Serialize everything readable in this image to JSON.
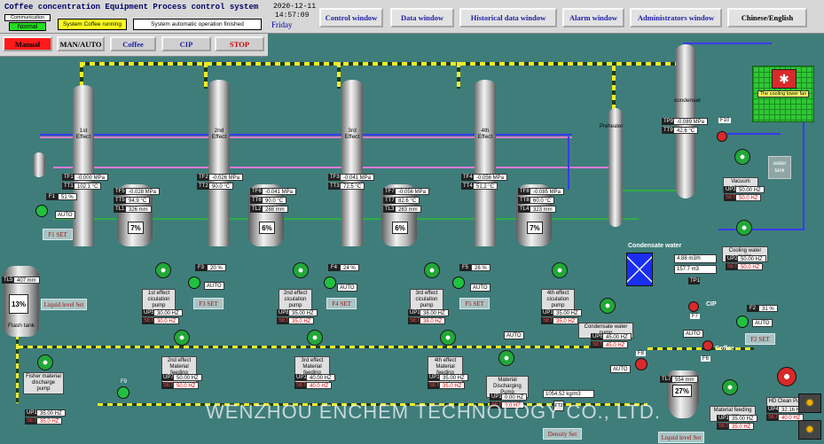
{
  "header": {
    "title": "Coffee concentration Equipment  Process control system",
    "communication_label": "Communication",
    "status_normal": "Normal",
    "status_running": "System Coffee running",
    "status_message": "System automatic operation finished",
    "date": "2020-12-11",
    "time": "14:57:09",
    "weekday": "Friday"
  },
  "controls": {
    "manual": "Manual",
    "man_auto": "MAN/AUTO",
    "coffee": "Coffee",
    "cip": "CIP",
    "stop": "STOP"
  },
  "nav": [
    "Control window",
    "Data window",
    "Historical data window",
    "Alarm window",
    "Administrators window",
    "Chinese/English"
  ],
  "columns": [
    {
      "label": "1st Effect",
      "tf_tag": "TF1",
      "tf": "-0.000 MPa",
      "tt_tag": "TT1",
      "tt": "102.1 °C",
      "pct": "7%"
    },
    {
      "label": "2nd Effect",
      "tf_tag": "TF2",
      "tf": "-0.026 MPa",
      "tt_tag": "TT2",
      "tt": "90.0 °C",
      "pct": "6%"
    },
    {
      "label": "3rd Effect",
      "tf_tag": "TF3",
      "tf": "-0.041 MPa",
      "tt_tag": "TT3",
      "tt": "72.5 °C",
      "pct": "6%"
    },
    {
      "label": "4th Effect",
      "tf_tag": "TF4",
      "tf": "-0.056 MPa",
      "tt_tag": "TT4",
      "tt": "51.2 °C",
      "pct": "7%"
    }
  ],
  "tanks": [
    {
      "a_tag": "TF5",
      "a": "-0.028 MPa",
      "b_tag": "TT5",
      "b": "94.9 °C",
      "c_tag": "TL1",
      "c": "326 mm"
    },
    {
      "a_tag": "TF6",
      "a": "-0.041 MPa",
      "b_tag": "TT6",
      "b": "90.0 °C",
      "c_tag": "TL2",
      "c": "288 mm"
    },
    {
      "a_tag": "TF7",
      "a": "-0.056 MPa",
      "b_tag": "TT7",
      "b": "82.6 °C",
      "c_tag": "TL3",
      "c": "283 mm"
    },
    {
      "a_tag": "TF8",
      "a": "-0.085 MPa",
      "b_tag": "TT8",
      "b": "60.0 °C",
      "c_tag": "TL4",
      "c": "323 mm"
    }
  ],
  "condenser": {
    "label": "condenser",
    "a_tag": "TP9",
    "a": "-0.089 MPa",
    "b_tag": "TT9",
    "b": "42.6 °C"
  },
  "preheater_label": "Preheater",
  "cooling_tower_label": "The cooling tower fan",
  "water_tank_label": "water tank",
  "flash_tank": {
    "label": "Flash tank",
    "level_tag": "TL5",
    "level": "407 mm",
    "pct": "13%"
  },
  "circ_pumps": [
    {
      "label": "1st effect ciculation pump",
      "up_tag": "UP5",
      "up": "30.00 HZ",
      "set": "30.0 HZ"
    },
    {
      "label": "2nd effect ciculation pump",
      "up_tag": "UP8",
      "up": "35.00 HZ",
      "set": "35.0 HZ"
    },
    {
      "label": "3rd effect ciculation pump",
      "up_tag": "UP11",
      "up": "38.00 HZ",
      "set": "38.0 HZ"
    },
    {
      "label": "4th effect ciculation pump",
      "up_tag": "UP13",
      "up": "35.00 HZ",
      "set": "35.0 HZ"
    }
  ],
  "feed_pumps": [
    {
      "label": "2nd effect Material feeding pump",
      "up_tag": "UP7",
      "up": "50.00 HZ",
      "set": "50.0 HZ"
    },
    {
      "label": "3rd effect Material feeding pump",
      "up_tag": "UP10",
      "up": "40.00 HZ",
      "set": "40.0 HZ"
    },
    {
      "label": "4th effect Material feeding pump",
      "up_tag": "UP12",
      "up": "35.00 HZ",
      "set": "35.0 HZ"
    }
  ],
  "flowmeters": [
    {
      "tag": "F1",
      "val": "51 %",
      "set": "F1 SET"
    },
    {
      "tag": "F3",
      "val": "20 %",
      "set": "F3 SET"
    },
    {
      "tag": "F4",
      "val": "24 %",
      "set": "F4 SET"
    },
    {
      "tag": "F5",
      "val": "28 %",
      "set": "F5 SET"
    },
    {
      "tag": "F2",
      "val": "31 %",
      "set": "F2 SET"
    }
  ],
  "auto_label": "AUTO",
  "liquid_level_set": "Liquid level Set",
  "fisher_pump": {
    "label": "Fisher material discharge pump",
    "up_tag": "UP15",
    "up": "35.00 HZ",
    "set": "35.0 HZ"
  },
  "discharge_pump": {
    "label": "Material Discharging Pump",
    "up_tag": "UP14",
    "up": "0.00 HZ",
    "set": "0.0 HZ"
  },
  "condensate": {
    "label": "Condensate water",
    "flow": "4.88  m3/h",
    "total": "157.7  m3",
    "pump_label": "Condensate water pump",
    "up_tag": "UP6",
    "up": "45.00 HZ",
    "set": "45.0 HZ",
    "tp_tag": "TP1"
  },
  "vacuum_pump": {
    "label": "Vacuum pump",
    "up_tag": "UP3",
    "up": "50.00 HZ",
    "set": "50.0 HZ"
  },
  "cooling_pump": {
    "label": "Cooling water pump",
    "up_tag": "UP2",
    "up": "50.00 HZ",
    "set": "50.0 HZ"
  },
  "density": {
    "value": "1054.52 kg/m3",
    "tag": "ET2",
    "set": "Density Set"
  },
  "final_tank": {
    "tag": "TL7",
    "level": "554 mm",
    "pct": "27%",
    "set": "Liquid level Set"
  },
  "final_feed_pump": {
    "label": "Material feeding pump",
    "up_tag": "UP1",
    "up": "35.00 HZ",
    "set": "35.0 HZ"
  },
  "hd_pump": {
    "label": "HD Clean Pu",
    "up_tag": "UP4",
    "up": "32.16 HZ",
    "set": "40.0 HZ"
  },
  "valves": [
    "F9",
    "F8",
    "F7",
    "F6",
    "F10"
  ],
  "cip_label": "CIP",
  "coffee_label": "Coffee",
  "watermark": "WENZHOU ENCHEM TECHNOLOGY CO., LTD.",
  "colors": {
    "background": "#3f7d7b",
    "steam": "#e07ad8",
    "product": "#2fae48",
    "cooling": "#3a3af0",
    "vapor_line": "#f2ea2a"
  }
}
